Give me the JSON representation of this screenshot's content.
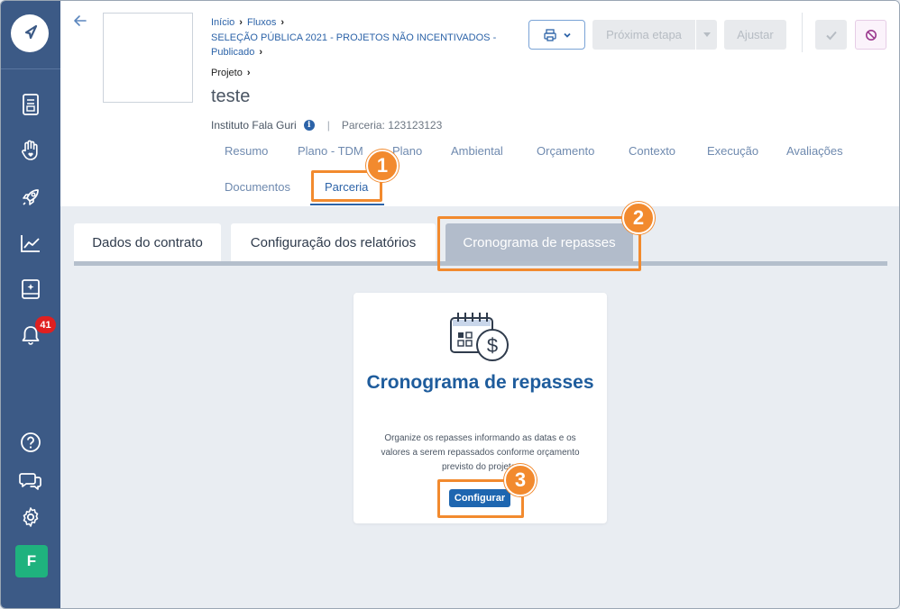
{
  "sidebar": {
    "icons": [
      "navigation-logo-icon",
      "document-icon",
      "hand-heart-icon",
      "rocket-icon",
      "chart-icon",
      "book-icon",
      "bell-icon",
      "help-icon",
      "chat-icon",
      "gear-icon"
    ],
    "notification_count": "41",
    "avatar_initial": "F"
  },
  "header": {
    "breadcrumb": {
      "inicio": "Início",
      "fluxos": "Fluxos",
      "selecao": "SELEÇÃO PÚBLICA 2021 - PROJETOS NÃO INCENTIVADOS - Publicado",
      "projeto": "Projeto"
    },
    "title": "teste",
    "institution": "Instituto Fala Guri",
    "partnership": "Parceria: 123123123",
    "actions": {
      "next_stage": "Próxima etapa",
      "adjust": "Ajustar"
    }
  },
  "tabs": [
    {
      "label": "Resumo"
    },
    {
      "label": "Plano - TDM"
    },
    {
      "label": "Plano"
    },
    {
      "label": "Ambiental"
    },
    {
      "label": "Orçamento"
    },
    {
      "label": "Contexto"
    },
    {
      "label": "Execução"
    },
    {
      "label": "Avaliações"
    },
    {
      "label": "Documentos"
    },
    {
      "label": "Parceria",
      "active": true
    }
  ],
  "subtabs": [
    {
      "label": "Dados do contrato"
    },
    {
      "label": "Configuração dos relatórios"
    },
    {
      "label": "Cronograma de repasses",
      "active": true
    }
  ],
  "card": {
    "title": "Cronograma de repasses",
    "description": "Organize os repasses informando as datas e os valores a serem repassados conforme orçamento previsto do projeto.",
    "button": "Configurar"
  },
  "annotations": [
    "1",
    "2",
    "3"
  ],
  "colors": {
    "sidebar": "#3c5a86",
    "accent": "#2c63a8",
    "highlight": "#f28a2e",
    "badge": "#e02020",
    "avatar": "#1fb27e"
  }
}
